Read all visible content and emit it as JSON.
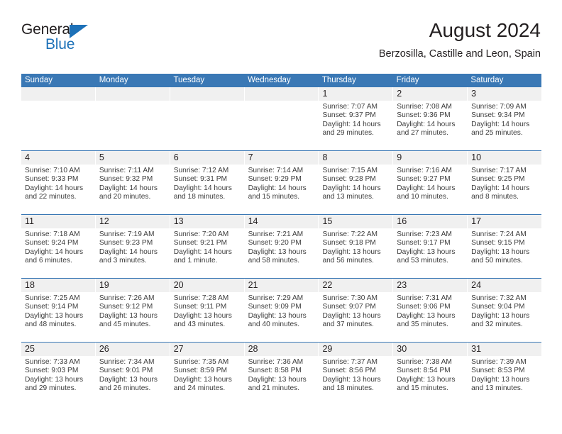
{
  "brand": {
    "name_part1": "General",
    "name_part2": "Blue",
    "triangle_color": "#1d71b8",
    "text_color": "#231f20"
  },
  "header": {
    "title": "August 2024",
    "subtitle": "Berzosilla, Castille and Leon, Spain"
  },
  "theme": {
    "accent": "#3a78b5",
    "daynum_band": "#f0f0f0",
    "cell_background": "#ffffff",
    "text": "#231f20",
    "info_text": "#3c3c3c"
  },
  "calendar": {
    "weekdays": [
      "Sunday",
      "Monday",
      "Tuesday",
      "Wednesday",
      "Thursday",
      "Friday",
      "Saturday"
    ],
    "weeks": [
      [
        {
          "day": "",
          "empty": true
        },
        {
          "day": "",
          "empty": true
        },
        {
          "day": "",
          "empty": true
        },
        {
          "day": "",
          "empty": true
        },
        {
          "day": "1",
          "sunrise": "Sunrise: 7:07 AM",
          "sunset": "Sunset: 9:37 PM",
          "daylight1": "Daylight: 14 hours",
          "daylight2": "and 29 minutes."
        },
        {
          "day": "2",
          "sunrise": "Sunrise: 7:08 AM",
          "sunset": "Sunset: 9:36 PM",
          "daylight1": "Daylight: 14 hours",
          "daylight2": "and 27 minutes."
        },
        {
          "day": "3",
          "sunrise": "Sunrise: 7:09 AM",
          "sunset": "Sunset: 9:34 PM",
          "daylight1": "Daylight: 14 hours",
          "daylight2": "and 25 minutes."
        }
      ],
      [
        {
          "day": "4",
          "sunrise": "Sunrise: 7:10 AM",
          "sunset": "Sunset: 9:33 PM",
          "daylight1": "Daylight: 14 hours",
          "daylight2": "and 22 minutes."
        },
        {
          "day": "5",
          "sunrise": "Sunrise: 7:11 AM",
          "sunset": "Sunset: 9:32 PM",
          "daylight1": "Daylight: 14 hours",
          "daylight2": "and 20 minutes."
        },
        {
          "day": "6",
          "sunrise": "Sunrise: 7:12 AM",
          "sunset": "Sunset: 9:31 PM",
          "daylight1": "Daylight: 14 hours",
          "daylight2": "and 18 minutes."
        },
        {
          "day": "7",
          "sunrise": "Sunrise: 7:14 AM",
          "sunset": "Sunset: 9:29 PM",
          "daylight1": "Daylight: 14 hours",
          "daylight2": "and 15 minutes."
        },
        {
          "day": "8",
          "sunrise": "Sunrise: 7:15 AM",
          "sunset": "Sunset: 9:28 PM",
          "daylight1": "Daylight: 14 hours",
          "daylight2": "and 13 minutes."
        },
        {
          "day": "9",
          "sunrise": "Sunrise: 7:16 AM",
          "sunset": "Sunset: 9:27 PM",
          "daylight1": "Daylight: 14 hours",
          "daylight2": "and 10 minutes."
        },
        {
          "day": "10",
          "sunrise": "Sunrise: 7:17 AM",
          "sunset": "Sunset: 9:25 PM",
          "daylight1": "Daylight: 14 hours",
          "daylight2": "and 8 minutes."
        }
      ],
      [
        {
          "day": "11",
          "sunrise": "Sunrise: 7:18 AM",
          "sunset": "Sunset: 9:24 PM",
          "daylight1": "Daylight: 14 hours",
          "daylight2": "and 6 minutes."
        },
        {
          "day": "12",
          "sunrise": "Sunrise: 7:19 AM",
          "sunset": "Sunset: 9:23 PM",
          "daylight1": "Daylight: 14 hours",
          "daylight2": "and 3 minutes."
        },
        {
          "day": "13",
          "sunrise": "Sunrise: 7:20 AM",
          "sunset": "Sunset: 9:21 PM",
          "daylight1": "Daylight: 14 hours",
          "daylight2": "and 1 minute."
        },
        {
          "day": "14",
          "sunrise": "Sunrise: 7:21 AM",
          "sunset": "Sunset: 9:20 PM",
          "daylight1": "Daylight: 13 hours",
          "daylight2": "and 58 minutes."
        },
        {
          "day": "15",
          "sunrise": "Sunrise: 7:22 AM",
          "sunset": "Sunset: 9:18 PM",
          "daylight1": "Daylight: 13 hours",
          "daylight2": "and 56 minutes."
        },
        {
          "day": "16",
          "sunrise": "Sunrise: 7:23 AM",
          "sunset": "Sunset: 9:17 PM",
          "daylight1": "Daylight: 13 hours",
          "daylight2": "and 53 minutes."
        },
        {
          "day": "17",
          "sunrise": "Sunrise: 7:24 AM",
          "sunset": "Sunset: 9:15 PM",
          "daylight1": "Daylight: 13 hours",
          "daylight2": "and 50 minutes."
        }
      ],
      [
        {
          "day": "18",
          "sunrise": "Sunrise: 7:25 AM",
          "sunset": "Sunset: 9:14 PM",
          "daylight1": "Daylight: 13 hours",
          "daylight2": "and 48 minutes."
        },
        {
          "day": "19",
          "sunrise": "Sunrise: 7:26 AM",
          "sunset": "Sunset: 9:12 PM",
          "daylight1": "Daylight: 13 hours",
          "daylight2": "and 45 minutes."
        },
        {
          "day": "20",
          "sunrise": "Sunrise: 7:28 AM",
          "sunset": "Sunset: 9:11 PM",
          "daylight1": "Daylight: 13 hours",
          "daylight2": "and 43 minutes."
        },
        {
          "day": "21",
          "sunrise": "Sunrise: 7:29 AM",
          "sunset": "Sunset: 9:09 PM",
          "daylight1": "Daylight: 13 hours",
          "daylight2": "and 40 minutes."
        },
        {
          "day": "22",
          "sunrise": "Sunrise: 7:30 AM",
          "sunset": "Sunset: 9:07 PM",
          "daylight1": "Daylight: 13 hours",
          "daylight2": "and 37 minutes."
        },
        {
          "day": "23",
          "sunrise": "Sunrise: 7:31 AM",
          "sunset": "Sunset: 9:06 PM",
          "daylight1": "Daylight: 13 hours",
          "daylight2": "and 35 minutes."
        },
        {
          "day": "24",
          "sunrise": "Sunrise: 7:32 AM",
          "sunset": "Sunset: 9:04 PM",
          "daylight1": "Daylight: 13 hours",
          "daylight2": "and 32 minutes."
        }
      ],
      [
        {
          "day": "25",
          "sunrise": "Sunrise: 7:33 AM",
          "sunset": "Sunset: 9:03 PM",
          "daylight1": "Daylight: 13 hours",
          "daylight2": "and 29 minutes."
        },
        {
          "day": "26",
          "sunrise": "Sunrise: 7:34 AM",
          "sunset": "Sunset: 9:01 PM",
          "daylight1": "Daylight: 13 hours",
          "daylight2": "and 26 minutes."
        },
        {
          "day": "27",
          "sunrise": "Sunrise: 7:35 AM",
          "sunset": "Sunset: 8:59 PM",
          "daylight1": "Daylight: 13 hours",
          "daylight2": "and 24 minutes."
        },
        {
          "day": "28",
          "sunrise": "Sunrise: 7:36 AM",
          "sunset": "Sunset: 8:58 PM",
          "daylight1": "Daylight: 13 hours",
          "daylight2": "and 21 minutes."
        },
        {
          "day": "29",
          "sunrise": "Sunrise: 7:37 AM",
          "sunset": "Sunset: 8:56 PM",
          "daylight1": "Daylight: 13 hours",
          "daylight2": "and 18 minutes."
        },
        {
          "day": "30",
          "sunrise": "Sunrise: 7:38 AM",
          "sunset": "Sunset: 8:54 PM",
          "daylight1": "Daylight: 13 hours",
          "daylight2": "and 15 minutes."
        },
        {
          "day": "31",
          "sunrise": "Sunrise: 7:39 AM",
          "sunset": "Sunset: 8:53 PM",
          "daylight1": "Daylight: 13 hours",
          "daylight2": "and 13 minutes."
        }
      ]
    ]
  }
}
